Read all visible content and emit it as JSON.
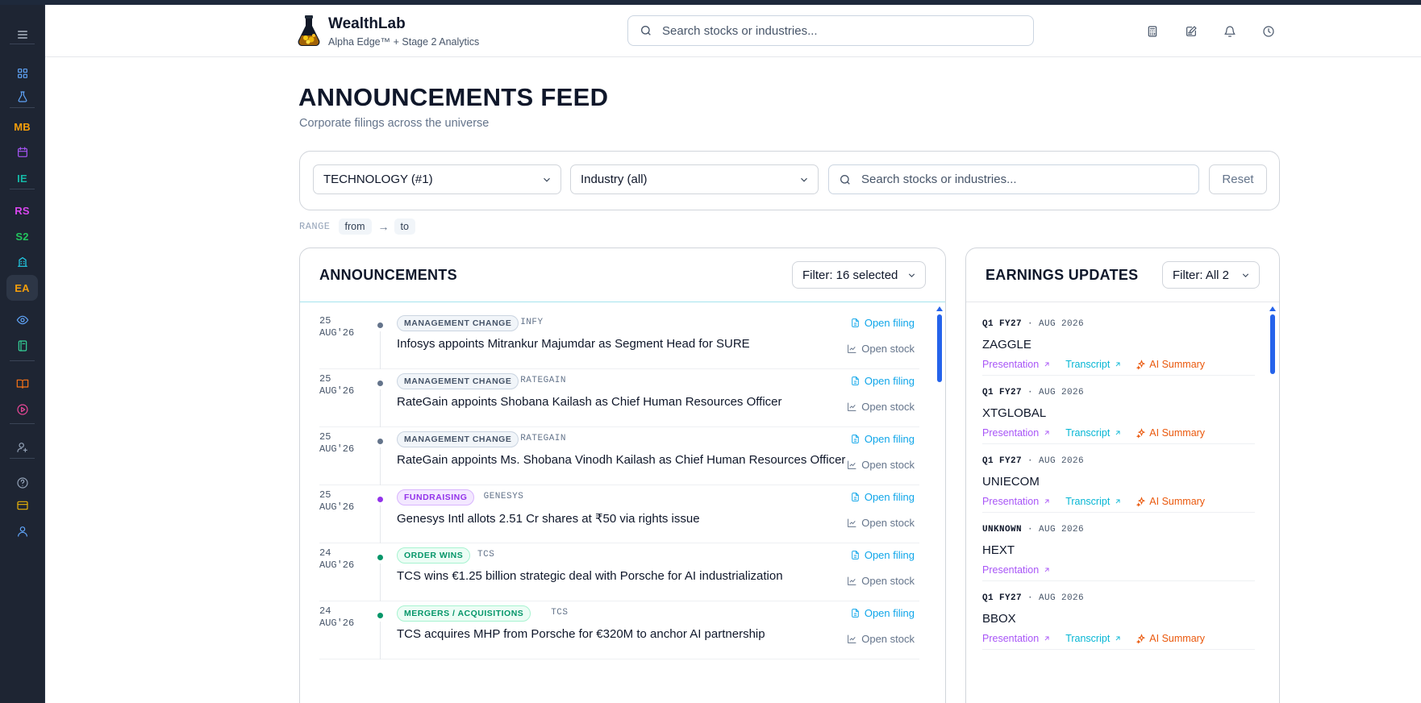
{
  "app": {
    "name": "WealthLab",
    "tagline": "Alpha Edge™ + Stage 2 Analytics"
  },
  "header": {
    "search_placeholder": "Search stocks or industries...",
    "icons": [
      "calculator-icon",
      "edit-note-icon",
      "bell-icon",
      "clock-icon"
    ]
  },
  "sidebar": {
    "items": [
      {
        "type": "icon",
        "name": "menu-icon"
      },
      {
        "type": "icon",
        "name": "dashboard-icon"
      },
      {
        "type": "icon",
        "name": "flask-icon"
      },
      {
        "type": "text",
        "label": "MB",
        "color": "#f59e0b"
      },
      {
        "type": "icon",
        "name": "calendar-icon"
      },
      {
        "type": "text",
        "label": "IE",
        "color": "#14b8a6"
      },
      {
        "type": "text",
        "label": "RS",
        "color": "#d946ef"
      },
      {
        "type": "text",
        "label": "S2",
        "color": "#22c55e"
      },
      {
        "type": "icon",
        "name": "building-icon"
      },
      {
        "type": "text",
        "label": "EA",
        "color": "#f59e0b",
        "active": true
      },
      {
        "type": "icon",
        "name": "eye-icon"
      },
      {
        "type": "icon",
        "name": "notebook-icon"
      },
      {
        "type": "icon",
        "name": "book-icon"
      },
      {
        "type": "icon",
        "name": "play-circle-icon"
      },
      {
        "type": "icon",
        "name": "user-settings-icon"
      },
      {
        "type": "icon",
        "name": "help-icon"
      },
      {
        "type": "icon",
        "name": "credit-card-icon"
      },
      {
        "type": "icon",
        "name": "user-icon"
      }
    ]
  },
  "page": {
    "title": "ANNOUNCEMENTS FEED",
    "subtitle": "Corporate filings across the universe"
  },
  "filters": {
    "sector_value": "TECHNOLOGY (#1)",
    "industry_value": "Industry (all)",
    "search_placeholder": "Search stocks or industries...",
    "reset_label": "Reset",
    "range_label": "RANGE",
    "range_from": "from",
    "range_arrow": "→",
    "range_to": "to"
  },
  "announcements": {
    "title": "ANNOUNCEMENTS",
    "filter_label": "Filter: 16 selected",
    "open_filing_label": "Open filing",
    "open_stock_label": "Open stock",
    "rows": [
      {
        "day": "25",
        "month": "AUG'26",
        "tag": "MANAGEMENT CHANGE",
        "ticker": "INFY",
        "title": "Infosys appoints Mitrankur Majumdar as Segment Head for SURE",
        "color": "#64748b"
      },
      {
        "day": "25",
        "month": "AUG'26",
        "tag": "MANAGEMENT CHANGE",
        "ticker": "RATEGAIN",
        "title": "RateGain appoints Shobana Kailash as Chief Human Resources Officer",
        "color": "#64748b"
      },
      {
        "day": "25",
        "month": "AUG'26",
        "tag": "MANAGEMENT CHANGE",
        "ticker": "RATEGAIN",
        "title": "RateGain appoints Ms. Shobana Vinodh Kailash as Chief Human Resources Officer",
        "color": "#64748b"
      },
      {
        "day": "25",
        "month": "AUG'26",
        "tag": "FUNDRAISING",
        "ticker": "GENESYS",
        "title": "Genesys Intl allots 2.51 Cr shares at ₹50 via rights issue",
        "color": "#9333ea"
      },
      {
        "day": "24",
        "month": "AUG'26",
        "tag": "ORDER WINS",
        "ticker": "TCS",
        "title": "TCS wins €1.25 billion strategic deal with Porsche for AI industrialization",
        "color": "#059669"
      },
      {
        "day": "24",
        "month": "AUG'26",
        "tag": "MERGERS / ACQUISITIONS",
        "ticker": "TCS",
        "title": "TCS acquires MHP from Porsche for €320M to anchor AI partnership",
        "color": "#059669"
      }
    ]
  },
  "earnings": {
    "title": "EARNINGS UPDATES",
    "filter_label": "Filter: All 2",
    "presentation_label": "Presentation",
    "transcript_label": "Transcript",
    "ai_summary_label": "AI Summary",
    "rows": [
      {
        "period": "Q1 FY27",
        "month": "AUG 2026",
        "name": "ZAGGLE",
        "links": [
          "presentation",
          "transcript",
          "ai_summary"
        ]
      },
      {
        "period": "Q1 FY27",
        "month": "AUG 2026",
        "name": "XTGLOBAL",
        "links": [
          "presentation",
          "transcript",
          "ai_summary"
        ]
      },
      {
        "period": "Q1 FY27",
        "month": "AUG 2026",
        "name": "UNIECOM",
        "links": [
          "presentation",
          "transcript",
          "ai_summary"
        ]
      },
      {
        "period": "UNKNOWN",
        "month": "AUG 2026",
        "name": "HEXT",
        "links": [
          "presentation"
        ]
      },
      {
        "period": "Q1 FY27",
        "month": "AUG 2026",
        "name": "BBOX",
        "links": [
          "presentation",
          "transcript",
          "ai_summary"
        ]
      }
    ]
  },
  "colors": {
    "accent_blue": "#2563eb",
    "link_cyan": "#0ea5e9",
    "presentation": "#a855f7",
    "transcript": "#06b6d4",
    "ai_summary": "#ea580c"
  }
}
